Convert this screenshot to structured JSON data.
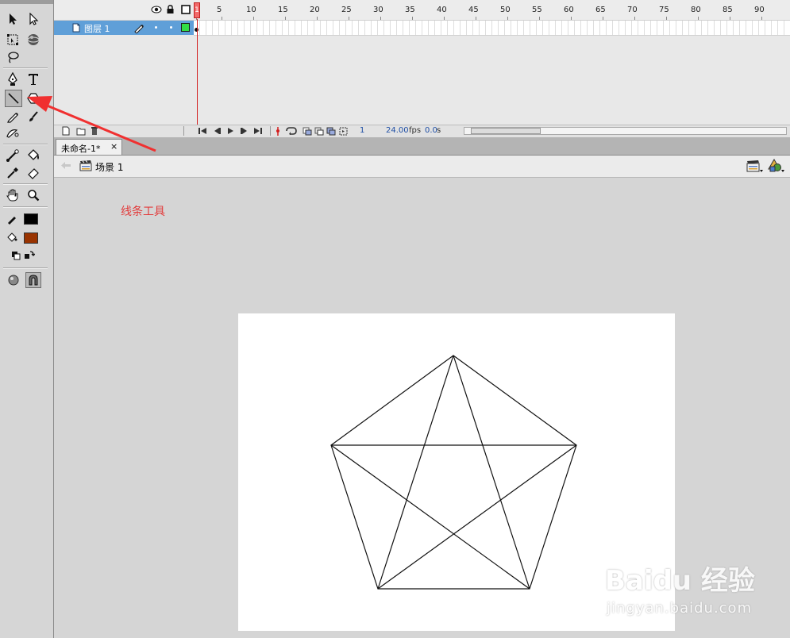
{
  "timeline": {
    "ruler": [
      "1",
      "5",
      "10",
      "15",
      "20",
      "25",
      "30",
      "35",
      "40",
      "45",
      "50",
      "55",
      "60",
      "65",
      "70",
      "75",
      "80",
      "85",
      "90"
    ],
    "layer_name": "图层 1",
    "current_frame": "1",
    "fps": "24.00",
    "fps_unit": "fps",
    "elapsed": "0.0",
    "elapsed_unit": "s"
  },
  "document": {
    "tab_label": "未命名-1*",
    "tab_close": "×",
    "scene_label": "场景 1"
  },
  "annotation": {
    "text": "线条工具",
    "color": "#e23b3b"
  },
  "colors": {
    "stroke_color": "#000000",
    "fill_color": "#993300",
    "layer_highlight": "#5f9fd8",
    "playhead": "#d21e1e"
  },
  "watermark": {
    "logo_text": "Baidu 经验",
    "url_text": "jingyan.baidu.com"
  }
}
